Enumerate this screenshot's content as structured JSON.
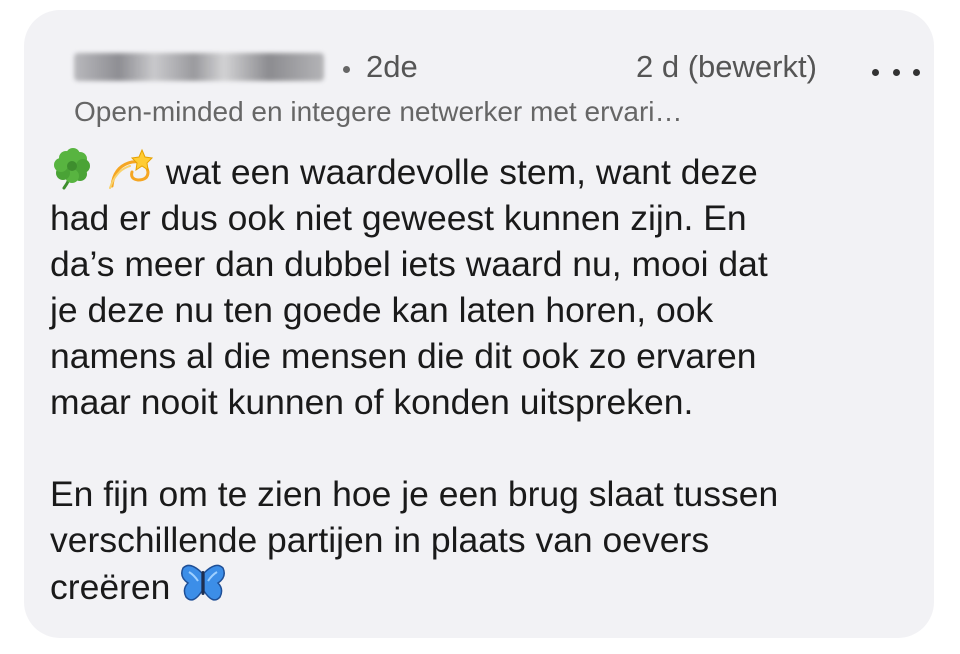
{
  "comment": {
    "author_name": "Arion Swal",
    "degree": "2de",
    "timestamp": "2 d (bewerkt)",
    "more_icon": "more-horizontal-icon",
    "headline": "Open-minded en integere netwerker met ervari…",
    "paragraph_1": {
      "emojis": [
        "four-leaf-clover-icon",
        "dizzy-icon"
      ],
      "lines": [
        "wat een waardevolle stem, want deze",
        "had er dus ook niet geweest kunnen zijn. En",
        "da’s meer dan dubbel iets waard nu, mooi dat",
        "je deze nu ten goede kan laten horen, ook",
        "namens al die mensen die dit ook zo ervaren",
        "maar nooit kunnen of konden uitspreken."
      ]
    },
    "paragraph_2": {
      "lines": [
        "En fijn om te zien hoe je een brug slaat tussen",
        "verschillende partijen in plaats van oevers",
        "creëren"
      ],
      "trailing_emoji": "butterfly-icon"
    }
  },
  "colors": {
    "card_background": "#f2f2f5",
    "text_primary": "#1a1a1a",
    "text_secondary": "#555555"
  }
}
